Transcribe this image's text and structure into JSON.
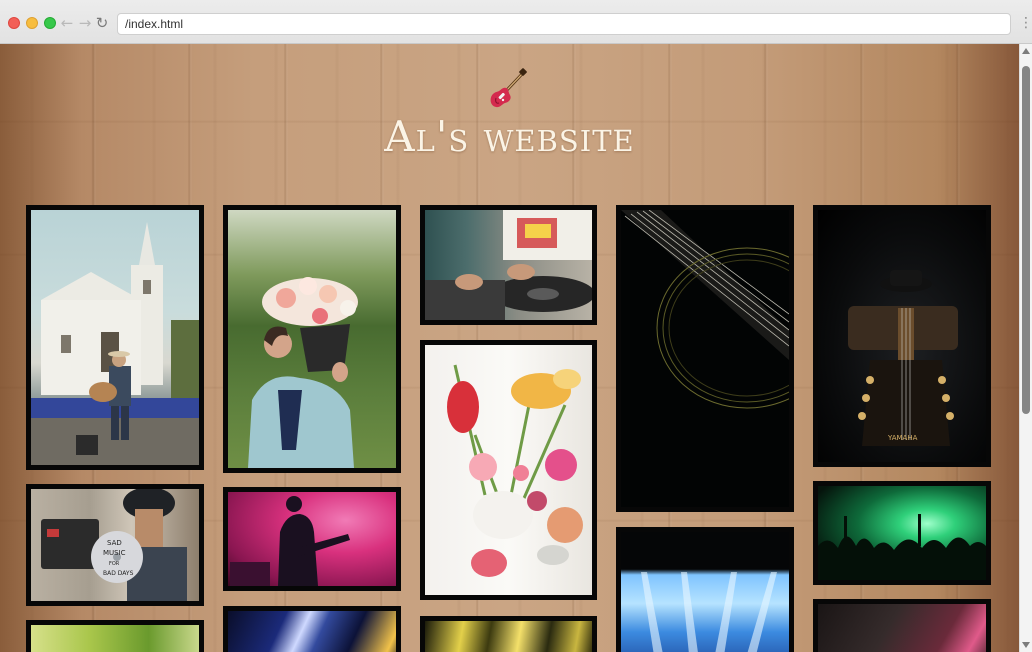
{
  "browser": {
    "url": "/index.html",
    "back_glyph": "←",
    "forward_glyph": "→",
    "reload_glyph": "↻",
    "menu_glyph": "⋮"
  },
  "site": {
    "title": "Al's website",
    "logo_icon": "electric-guitar-icon"
  },
  "gallery": {
    "images": [
      {
        "subject": "church-street-guitarist"
      },
      {
        "subject": "woman-with-flower-bucket"
      },
      {
        "subject": "dj-turntable"
      },
      {
        "subject": "acoustic-guitar-closeup"
      },
      {
        "subject": "guitar-headstock-yamaha",
        "headstock_text": "YAMAHA"
      },
      {
        "subject": "sad-music-cd",
        "cd_text": "SAD MUSIC FOR BAD DAYS"
      },
      {
        "subject": "guitarist-pink-stage"
      },
      {
        "subject": "flower-bouquet"
      },
      {
        "subject": "concert-crowd-green"
      },
      {
        "subject": "stage-blue-lights"
      },
      {
        "subject": "stage-lights"
      },
      {
        "subject": "light-beams"
      },
      {
        "subject": "plant-leaves"
      },
      {
        "subject": "singer-red-stage"
      }
    ]
  },
  "colors": {
    "title": "#fbf4e6",
    "frame": "#070707",
    "wood": "#c39b78"
  }
}
